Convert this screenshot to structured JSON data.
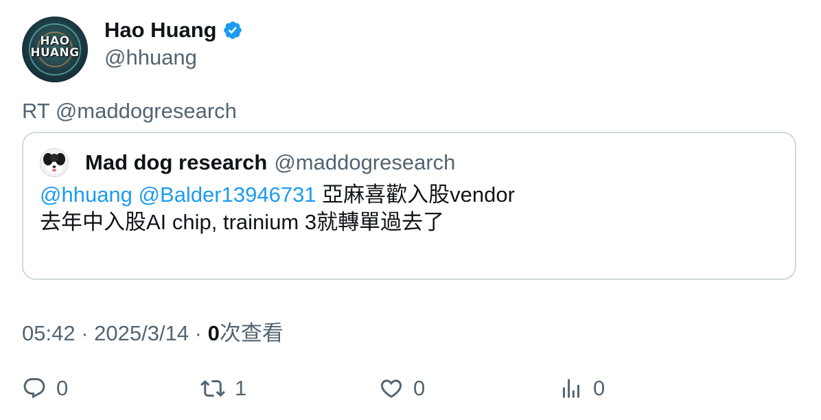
{
  "author": {
    "display_name": "Hao Huang",
    "handle": "@hhuang",
    "avatar_text_line1": "HAO",
    "avatar_text_line2": "HUANG",
    "verified": true
  },
  "retweet_label": "RT @maddogresearch",
  "quoted_tweet": {
    "display_name": "Mad dog research",
    "handle": "@maddogresearch",
    "mention_1": "@hhuang",
    "mention_2": "@Balder13946731",
    "line1_text": " 亞麻喜歡入股vendor",
    "line2_text": "去年中入股AI chip, trainium 3就轉單過去了"
  },
  "meta": {
    "time": "05:42",
    "separator": " · ",
    "date": "2025/3/14",
    "views_count": "0",
    "views_label": "次查看"
  },
  "actions": {
    "reply_count": "0",
    "retweet_count": "1",
    "like_count": "0",
    "views_count": "0"
  },
  "colors": {
    "accent": "#1d9bf0",
    "text_primary": "#0f1419",
    "text_secondary": "#536471",
    "border": "#cfd9de"
  },
  "icons": {
    "verified": "verified-badge-icon",
    "reply": "reply-icon",
    "retweet": "retweet-icon",
    "like": "heart-icon",
    "views": "analytics-icon"
  }
}
